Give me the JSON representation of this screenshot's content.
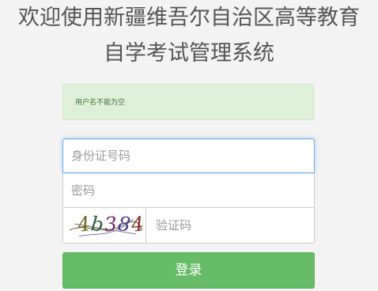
{
  "header": {
    "title_line1": "欢迎使用新疆维吾尔自治区高等教育",
    "title_line2": "自学考试管理系统"
  },
  "alert": {
    "message": "用户名不能为空",
    "color": "#3c763d",
    "background": "#dff0d8"
  },
  "form": {
    "id_placeholder": "身份证号码",
    "id_value": "",
    "password_placeholder": "密码",
    "password_value": "",
    "captcha_placeholder": "验证码",
    "captcha_value": "",
    "captcha_image_text": "4b384",
    "login_label": "登录"
  },
  "colors": {
    "login_button": "#5cb85c",
    "focus_border": "#66afe9"
  }
}
